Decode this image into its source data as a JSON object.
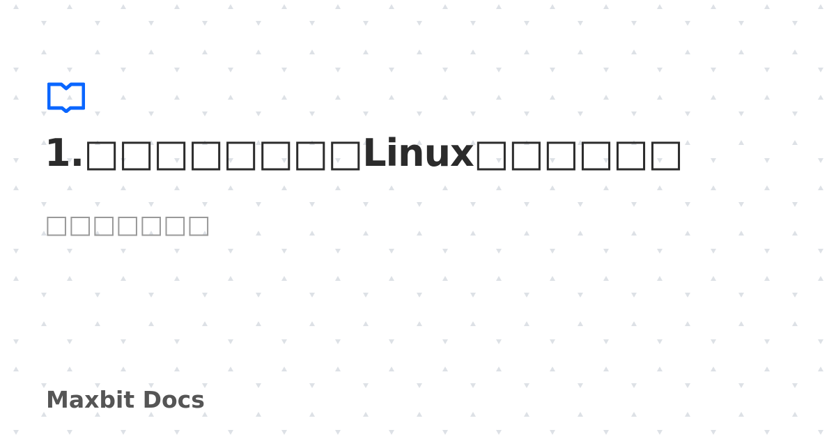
{
  "brand_color": "#0a66ff",
  "pattern_color": "#dde1e6",
  "icon": "book-open-icon",
  "title": "1.□□□□□□□□Linux□□□□□□",
  "subtitle": "□□□□□□□",
  "site_name": "Maxbit Docs"
}
